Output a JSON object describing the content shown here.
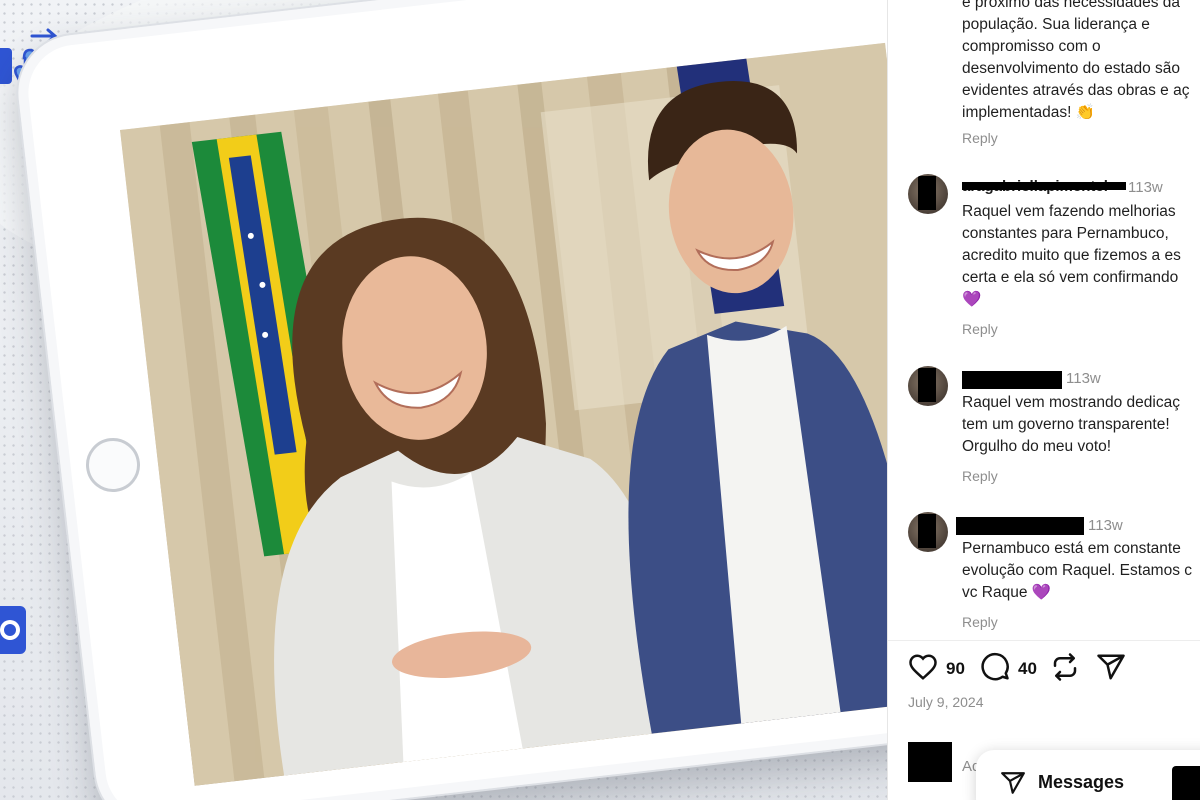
{
  "post": {
    "caption_fragment": "é próximo das necessidades da\npopulação. Sua liderança e\ncompromisso com o\ndesenvolvimento do estado são\nevidentes através das obras e aç\nimplementadas! 👏",
    "caption_reply": "Reply",
    "likes": "90",
    "comments_count": "40",
    "date": "July 9, 2024",
    "add_comment_placeholder": "Ad",
    "messages_label": "Messages"
  },
  "comments": [
    {
      "username": "aragabriellapimentel",
      "time": "113w",
      "text": "Raquel vem fazendo melhorias\nconstantes para Pernambuco,\nacredito muito que fizemos a es\ncerta e ela só vem confirmando\n💜",
      "reply": "Reply"
    },
    {
      "username": "",
      "time": "113w",
      "text": "Raquel vem mostrando dedicaç\ntem um governo transparente!\nOrgulho do meu voto!",
      "reply": "Reply"
    },
    {
      "username": "",
      "time": "113w",
      "text": "Pernambuco está em constante\nevolução com Raquel. Estamos c\nvc Raque 💜",
      "reply": "Reply"
    }
  ],
  "colors": {
    "brand_blue": "#2f55d4",
    "panel_bg": "#ffffff",
    "muted_text": "#8e8e8e"
  },
  "icons": [
    "hand-swipe-icon",
    "camera-icon",
    "heart-icon",
    "comment-icon",
    "repost-icon",
    "share-icon",
    "send-icon"
  ]
}
